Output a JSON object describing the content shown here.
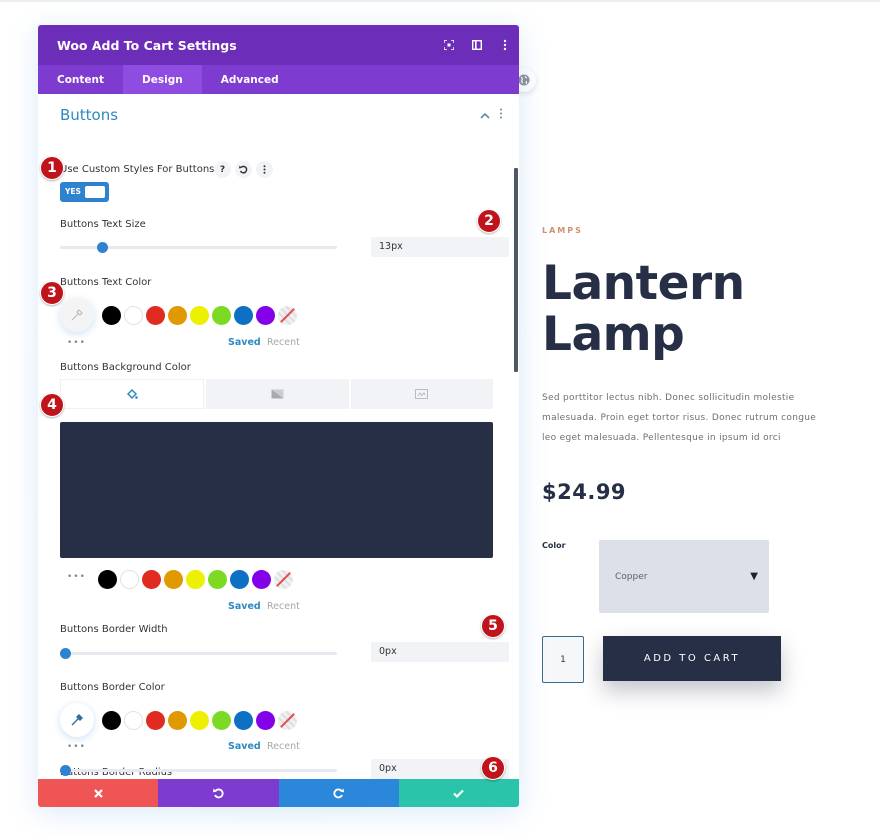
{
  "panel": {
    "title": "Woo Add To Cart Settings",
    "header_icons": [
      "focus-icon",
      "split-view-icon",
      "more-icon"
    ],
    "tabs": [
      {
        "label": "Content",
        "active": false
      },
      {
        "label": "Design",
        "active": true
      },
      {
        "label": "Advanced",
        "active": false
      }
    ],
    "section": {
      "title": "Buttons",
      "expanded": true
    },
    "fields": {
      "custom_styles": {
        "label": "Use Custom Styles For Buttons",
        "help": "?",
        "toggle_text": "YES",
        "value": true
      },
      "text_size": {
        "label": "Buttons Text Size",
        "value": "13px",
        "slider_fraction": 0.14
      },
      "text_color": {
        "label": "Buttons Text Color",
        "saved_label": "Saved",
        "recent_label": "Recent"
      },
      "background_color": {
        "label": "Buttons Background Color",
        "value": "#262f45",
        "saved_label": "Saved",
        "recent_label": "Recent"
      },
      "border_width": {
        "label": "Buttons Border Width",
        "value": "0px",
        "slider_fraction": 0.0
      },
      "border_color": {
        "label": "Buttons Border Color",
        "saved_label": "Saved",
        "recent_label": "Recent"
      },
      "border_radius": {
        "label": "Buttons Border Radius",
        "value": "0px",
        "slider_fraction": 0.0
      }
    },
    "swatches": [
      "#000000",
      "#ffffff",
      "#e02b20",
      "#e09900",
      "#edf000",
      "#7cda24",
      "#0c71c3",
      "#8300e9"
    ],
    "dots": "•••",
    "footer": {
      "cancel_color": "#ef5555",
      "undo_color": "#7e3bd0",
      "redo_color": "#2b87da",
      "save_color": "#29c4a9"
    }
  },
  "badges": [
    "1",
    "2",
    "3",
    "4",
    "5",
    "6"
  ],
  "product": {
    "category": "LAMPS",
    "title_line1": "Lantern",
    "title_line2": "Lamp",
    "description": "Sed porttitor lectus nibh. Donec sollicitudin molestie malesuada. Proin eget tortor risus. Donec rutrum congue leo eget malesuada. Pellentesque in ipsum id orci",
    "price": "$24.99",
    "color_label": "Color",
    "color_value": "Copper",
    "select_arrow": "▼",
    "quantity": "1",
    "add_to_cart": "ADD TO CART"
  }
}
